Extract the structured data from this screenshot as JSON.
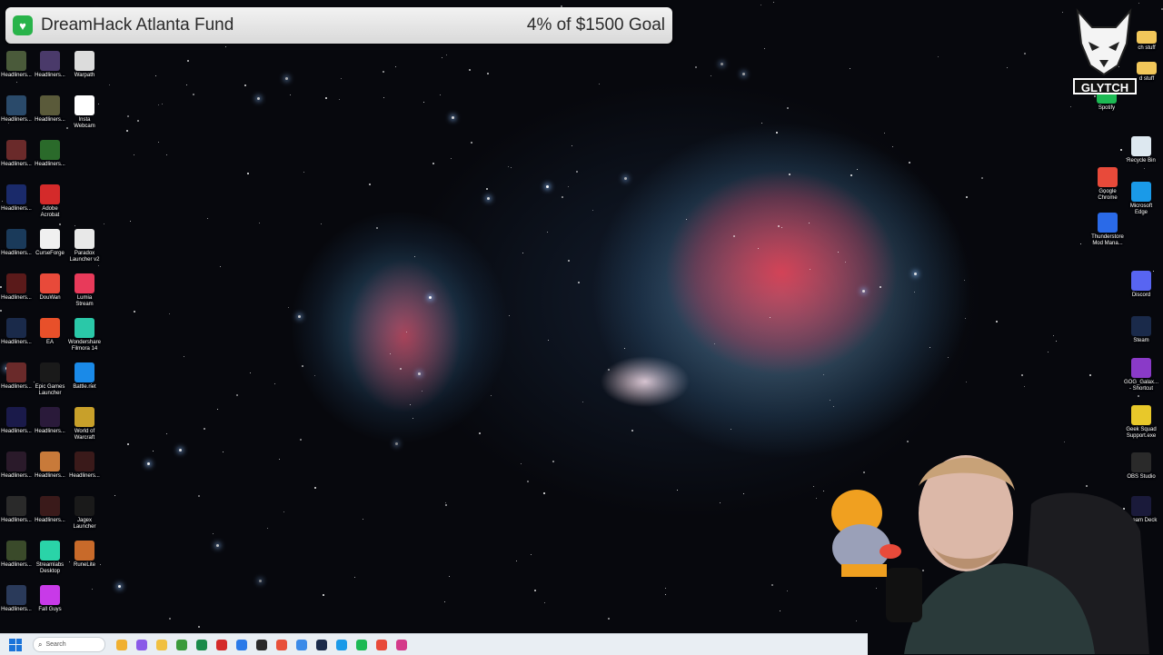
{
  "fund": {
    "title": "DreamHack Atlanta Fund",
    "goal": "4% of $1500 Goal",
    "progress_percent": 4
  },
  "desktop_left": [
    {
      "label": "Headliners...",
      "icon": "video-thumb-icon",
      "color": "#4a5a3a"
    },
    {
      "label": "Headliners...",
      "icon": "video-thumb-icon",
      "color": "#4a3a6a"
    },
    {
      "label": "Warpath",
      "icon": "warpath-icon",
      "color": "#dcdcdc"
    },
    {
      "label": "Headliners...",
      "icon": "video-thumb-icon",
      "color": "#2a4a6a"
    },
    {
      "label": "Headliners...",
      "icon": "video-thumb-icon",
      "color": "#5a5a3a"
    },
    {
      "label": "Insta\nWebcam",
      "icon": "webcam-icon",
      "color": "#ffffff"
    },
    {
      "label": "Headliners...",
      "icon": "video-thumb-icon",
      "color": "#6a2a2a"
    },
    {
      "label": "Headliners...",
      "icon": "video-thumb-icon",
      "color": "#2a6a2a"
    },
    {
      "label": "Headliners...",
      "icon": "video-thumb-icon",
      "color": "#1a2a6a"
    },
    {
      "label": "Adobe\nAcrobat",
      "icon": "acrobat-icon",
      "color": "#d42a2a"
    },
    {
      "label": "Headliners...",
      "icon": "video-thumb-icon",
      "color": "#1a3a5a"
    },
    {
      "label": "CurseForge",
      "icon": "curseforge-icon",
      "color": "#f0f0f0"
    },
    {
      "label": "Paradox\nLauncher v2",
      "icon": "paradox-icon",
      "color": "#e8e8e8"
    },
    {
      "label": "Headliners...",
      "icon": "video-thumb-icon",
      "color": "#5a1a1a"
    },
    {
      "label": "DouWan",
      "icon": "douwan-icon",
      "color": "#e84a3a"
    },
    {
      "label": "Lumia\nStream",
      "icon": "lumia-icon",
      "color": "#e83a5a"
    },
    {
      "label": "Headliners...",
      "icon": "video-thumb-icon",
      "color": "#1a2a4a"
    },
    {
      "label": "EA",
      "icon": "ea-icon",
      "color": "#e8502a"
    },
    {
      "label": "Wondershare\nFilmora 14",
      "icon": "filmora-icon",
      "color": "#2ac8a8"
    },
    {
      "label": "Headliners...",
      "icon": "video-thumb-icon",
      "color": "#6a2a2a"
    },
    {
      "label": "Epic Games\nLauncher",
      "icon": "epic-games-icon",
      "color": "#1a1a1a"
    },
    {
      "label": "Battle.net",
      "icon": "battlenet-icon",
      "color": "#1a8ae8"
    },
    {
      "label": "Headliners...",
      "icon": "video-thumb-icon",
      "color": "#1a1a4a"
    },
    {
      "label": "Headliners...",
      "icon": "video-thumb-icon",
      "color": "#2a1a3a"
    },
    {
      "label": "World of\nWarcraft",
      "icon": "wow-icon",
      "color": "#c8a02a"
    },
    {
      "label": "Headliners...",
      "icon": "video-thumb-icon",
      "color": "#2a1a2a"
    },
    {
      "label": "Headliners...",
      "icon": "video-thumb-icon",
      "color": "#c87a3a"
    },
    {
      "label": "Headliners...",
      "icon": "video-thumb-icon",
      "color": "#3a1a1a"
    },
    {
      "label": "Headliners...",
      "icon": "video-thumb-icon",
      "color": "#2a2a2a"
    },
    {
      "label": "Headliners...",
      "icon": "video-thumb-icon",
      "color": "#3a1a1a"
    },
    {
      "label": "Jagex\nLauncher",
      "icon": "jagex-icon",
      "color": "#1a1a1a"
    },
    {
      "label": "Headliners...",
      "icon": "video-thumb-icon",
      "color": "#3a4a2a"
    },
    {
      "label": "Streamlabs\nDesktop",
      "icon": "streamlabs-icon",
      "color": "#2ad4a8"
    },
    {
      "label": "RuneLite",
      "icon": "runelite-icon",
      "color": "#c86a2a"
    },
    {
      "label": "Headliners...",
      "icon": "video-thumb-icon",
      "color": "#2a3a5a"
    },
    {
      "label": "Fall Guys",
      "icon": "fall-guys-icon",
      "color": "#c83ae8"
    }
  ],
  "desktop_right": [
    {
      "label": "Spotify",
      "icon": "spotify-icon",
      "color": "#1db954"
    },
    {
      "label": "Recycle Bin",
      "icon": "recycle-bin-icon",
      "color": "#dde8f0"
    },
    {
      "label": "Google\nChrome",
      "icon": "chrome-icon",
      "color": "#e84a3a"
    },
    {
      "label": "Microsoft\nEdge",
      "icon": "edge-icon",
      "color": "#1a9ae8"
    },
    {
      "label": "Thunderstore\nMod Mana...",
      "icon": "thunderstore-icon",
      "color": "#2a6ae8"
    },
    {
      "label": "Discord",
      "icon": "discord-icon",
      "color": "#5865f2"
    },
    {
      "label": "Steam",
      "icon": "steam-icon",
      "color": "#1a2a4a"
    },
    {
      "label": "GOG_Galax...\n- Shortcut",
      "icon": "gog-galaxy-icon",
      "color": "#8a3ac8"
    },
    {
      "label": "Geek Squad\nSupport.exe",
      "icon": "geek-squad-icon",
      "color": "#e8c82a"
    },
    {
      "label": "OBS Studio",
      "icon": "obs-icon",
      "color": "#2a2a2a"
    },
    {
      "label": "Stream Deck",
      "icon": "stream-deck-icon",
      "color": "#1a1a3a"
    }
  ],
  "folders_right": [
    {
      "label": "ch stuff"
    },
    {
      "label": "d stuff"
    }
  ],
  "logo": {
    "text": "GLYTCH"
  },
  "taskbar": {
    "search_placeholder": "Search",
    "icons": [
      {
        "name": "weather-icon",
        "color": "#f0b030"
      },
      {
        "name": "copilot-icon",
        "color": "#8a5ae8"
      },
      {
        "name": "file-explorer-icon",
        "color": "#f0c040"
      },
      {
        "name": "minecraft-icon",
        "color": "#3a9a3a"
      },
      {
        "name": "excel-icon",
        "color": "#1a8a4a"
      },
      {
        "name": "acrobat-icon",
        "color": "#d42a2a"
      },
      {
        "name": "store-icon",
        "color": "#2a7ae8"
      },
      {
        "name": "obs-icon",
        "color": "#2a2a2a"
      },
      {
        "name": "snip-icon",
        "color": "#e8503a"
      },
      {
        "name": "photos-icon",
        "color": "#3a8ae8"
      },
      {
        "name": "steam-icon",
        "color": "#1a2a4a"
      },
      {
        "name": "edge-icon",
        "color": "#1a9ae8"
      },
      {
        "name": "spotify-icon",
        "color": "#1db954"
      },
      {
        "name": "chrome-icon",
        "color": "#e84a3a"
      },
      {
        "name": "instagram-icon",
        "color": "#d43a8a"
      }
    ]
  }
}
